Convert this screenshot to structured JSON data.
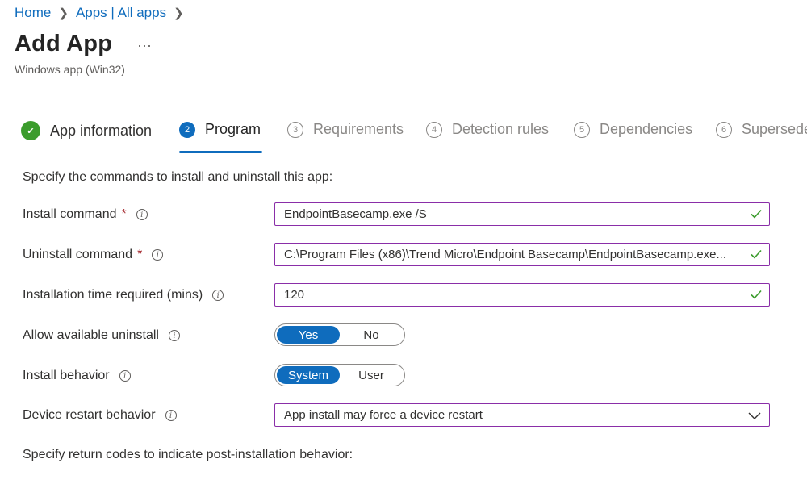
{
  "breadcrumb": {
    "home": "Home",
    "sep": ">",
    "apps": "Apps | All apps"
  },
  "header": {
    "title": "Add App",
    "more": "···",
    "subtitle": "Windows app (Win32)"
  },
  "steps": [
    {
      "number": "✔",
      "label": "App information",
      "state": "done"
    },
    {
      "number": "2",
      "label": "Program",
      "state": "active"
    },
    {
      "number": "3",
      "label": "Requirements",
      "state": "todo"
    },
    {
      "number": "4",
      "label": "Detection rules",
      "state": "todo"
    },
    {
      "number": "5",
      "label": "Dependencies",
      "state": "todo"
    },
    {
      "number": "6",
      "label": "Supersedence",
      "state": "todo"
    }
  ],
  "form": {
    "intro": "Specify the commands to install and uninstall this app:",
    "required_mark": "*",
    "info_glyph": "i",
    "install_command": {
      "label": "Install command",
      "value": "EndpointBasecamp.exe /S"
    },
    "uninstall_command": {
      "label": "Uninstall command",
      "value": "C:\\Program Files (x86)\\Trend Micro\\Endpoint Basecamp\\EndpointBasecamp.exe..."
    },
    "install_time": {
      "label": "Installation time required (mins)",
      "value": "120"
    },
    "allow_uninstall": {
      "label": "Allow available uninstall",
      "options": [
        "Yes",
        "No"
      ],
      "selected": "Yes"
    },
    "install_behavior": {
      "label": "Install behavior",
      "options": [
        "System",
        "User"
      ],
      "selected": "System"
    },
    "restart_behavior": {
      "label": "Device restart behavior",
      "value": "App install may force a device restart"
    },
    "outro": "Specify return codes to indicate post-installation behavior:"
  },
  "colors": {
    "accent": "#0f6cbd",
    "success": "#3b9c2c",
    "required": "#a4262c",
    "field_border": "#8a2ea8"
  }
}
